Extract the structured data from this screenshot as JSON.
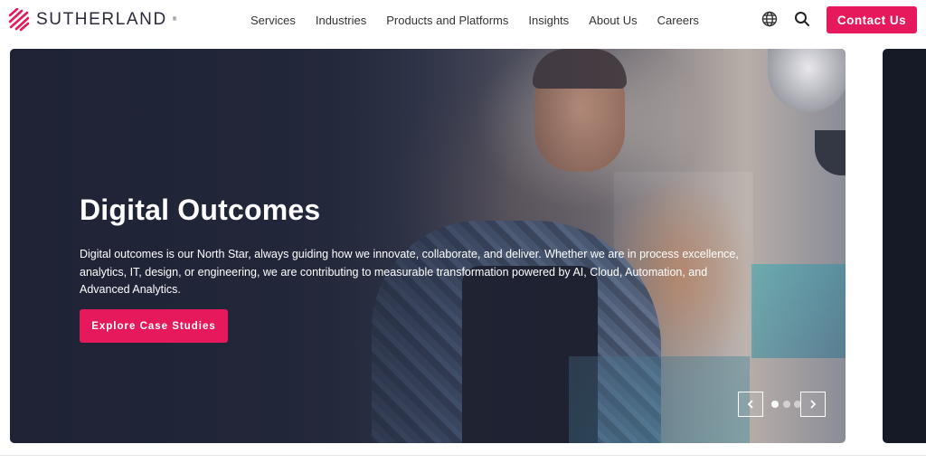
{
  "header": {
    "logo_text": "SUTHERLAND",
    "logo_tm": "®",
    "nav": [
      "Services",
      "Industries",
      "Products and Platforms",
      "Insights",
      "About Us",
      "Careers"
    ],
    "contact_label": "Contact Us"
  },
  "hero": {
    "title": "Digital Outcomes",
    "description": "Digital outcomes is our North Star, always guiding how we innovate, collaborate, and deliver. Whether we are in process excellence, analytics, IT, design, or engineering, we are contributing to measurable transformation powered by AI, Cloud, Automation, and Advanced Analytics.",
    "cta_label": "Explore Case Studies"
  },
  "carousel": {
    "dots": 3,
    "active_index": 0
  },
  "colors": {
    "accent": "#e5195b",
    "hero_dark": "#262b40"
  },
  "icons": {
    "logo": "sutherland-stripes-icon",
    "globe": "globe-icon",
    "search": "search-icon",
    "prev": "chevron-left-icon",
    "next": "chevron-right-icon"
  }
}
